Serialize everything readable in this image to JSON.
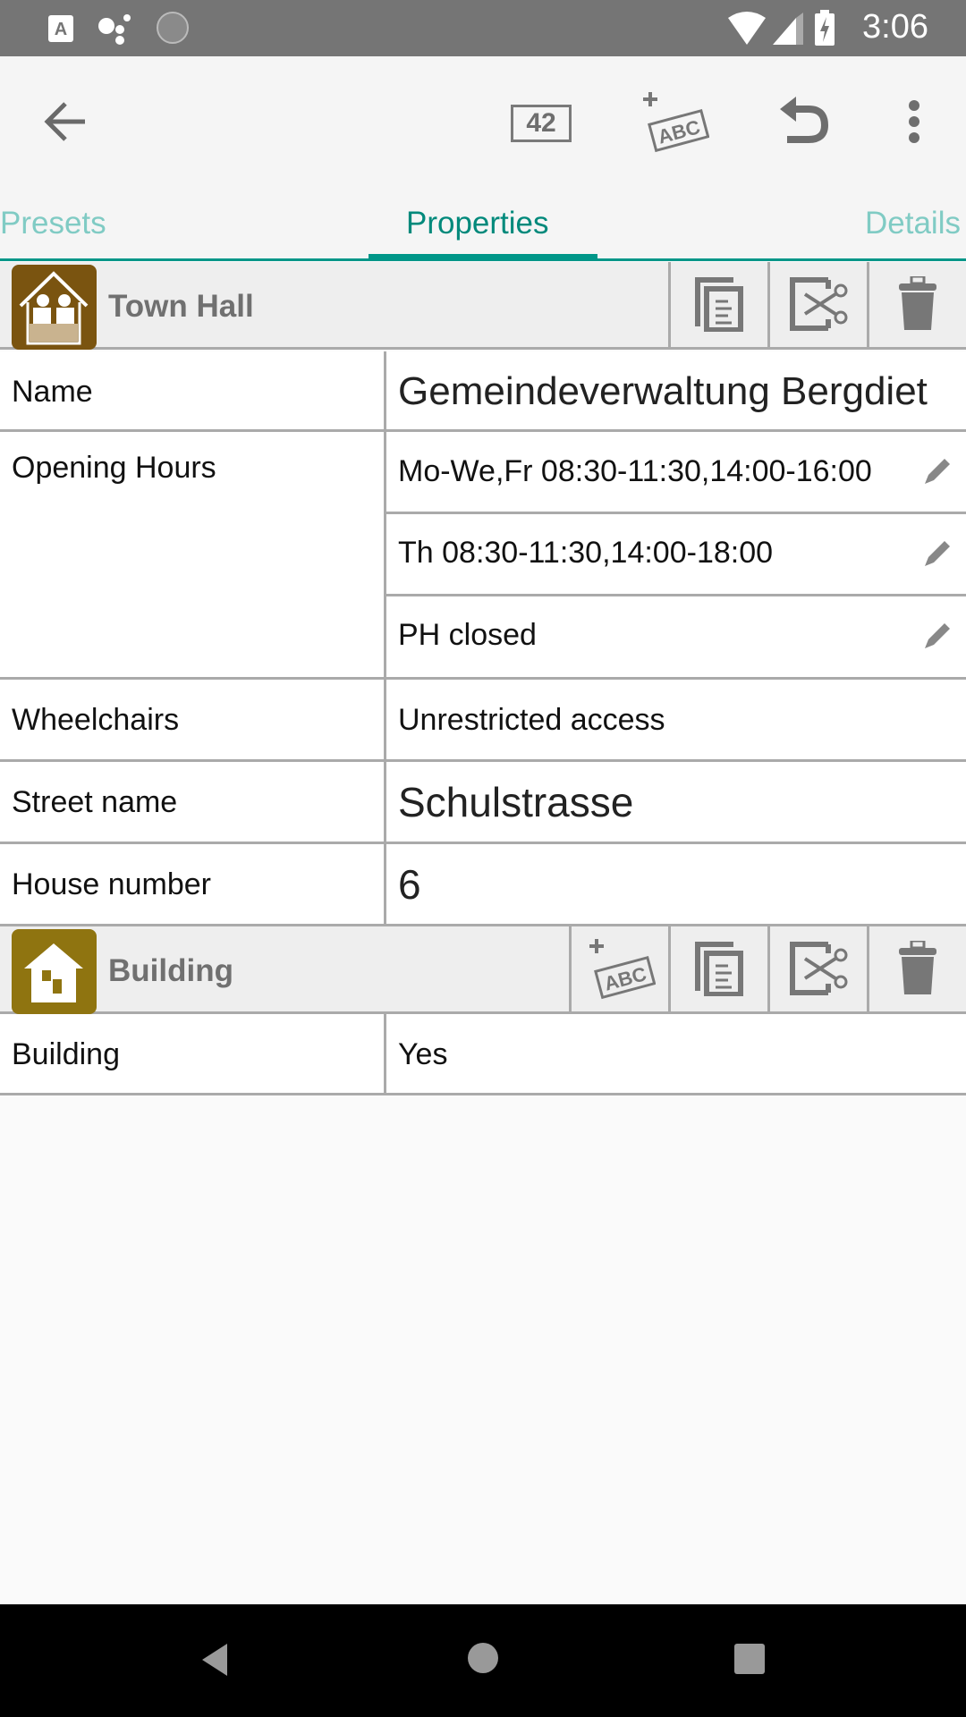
{
  "status_bar": {
    "time": "3:06",
    "left_icons": [
      "accessibility-a-icon",
      "assistant-dots-icon",
      "loading-spinner-icon"
    ],
    "right_icons": [
      "wifi-icon",
      "cell-signal-icon",
      "battery-charging-icon"
    ]
  },
  "toolbar": {
    "back_icon": "arrow-left-icon",
    "tag_count_label": "42",
    "add_tag_label": "ABC",
    "undo_icon": "undo-icon",
    "more_icon": "more-vert-icon"
  },
  "tabs": [
    {
      "label": "Presets",
      "active": false
    },
    {
      "label": "Properties",
      "active": true
    },
    {
      "label": "Details",
      "active": false
    }
  ],
  "colors": {
    "accent": "#009688",
    "town_hall_icon": "#7a5410",
    "building_icon": "#8f7410"
  },
  "sections": [
    {
      "preset": "Town Hall",
      "actions": [
        "copy-icon",
        "cut-icon",
        "delete-icon"
      ],
      "fields": [
        {
          "key": "Name",
          "value": "Gemeindeverwaltung Bergdiet"
        },
        {
          "key": "Opening Hours",
          "values": [
            "Mo-We,Fr 08:30-11:30,14:00-16:00",
            "Th 08:30-11:30,14:00-18:00",
            "PH closed"
          ]
        },
        {
          "key": "Wheelchairs",
          "value": "Unrestricted access"
        },
        {
          "key": "Street name",
          "value": "Schulstrasse"
        },
        {
          "key": "House number",
          "value": "6"
        }
      ]
    },
    {
      "preset": "Building",
      "add_tag_label": "ABC",
      "actions": [
        "add-tag-icon",
        "copy-icon",
        "cut-icon",
        "delete-icon"
      ],
      "fields": [
        {
          "key": "Building",
          "value": "Yes"
        }
      ]
    }
  ],
  "nav_bar": [
    "back-triangle-icon",
    "home-circle-icon",
    "recents-square-icon"
  ]
}
